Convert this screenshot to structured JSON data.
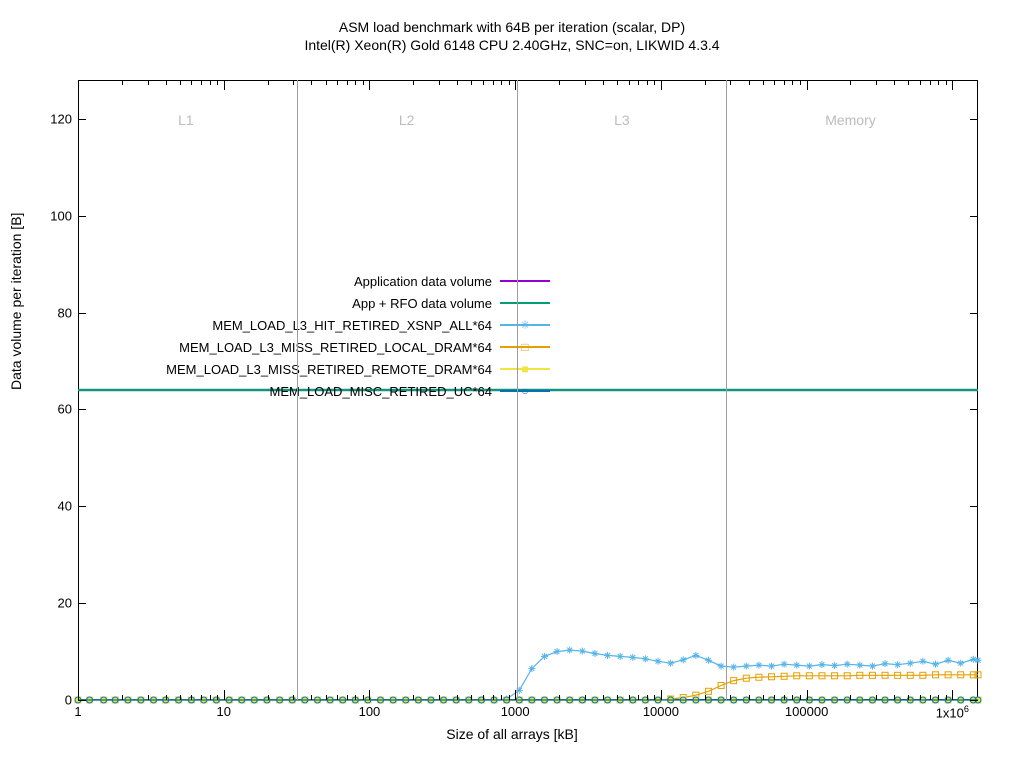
{
  "title": {
    "line1": "ASM load benchmark with 64B per iteration (scalar, DP)",
    "line2": "Intel(R) Xeon(R) Gold 6148 CPU 2.40GHz, SNC=on, LIKWID 4.3.4"
  },
  "axes": {
    "xlabel": "Size of all arrays [kB]",
    "ylabel": "Data volume per iteration [B]",
    "y_ticks": [
      0,
      20,
      40,
      60,
      80,
      100,
      120
    ],
    "x_ticks_log": [
      1,
      10,
      100,
      1000,
      10000,
      100000,
      1000000
    ],
    "x_tick_labels": [
      "1",
      "10",
      "100",
      "1000",
      "10000",
      "100000",
      "1x10⁶"
    ],
    "xlim": [
      1,
      1500000
    ],
    "ylim": [
      0,
      128
    ]
  },
  "regions": {
    "labels": [
      "L1",
      "L2",
      "L3",
      "Memory"
    ],
    "boundaries_kB": [
      32,
      1024,
      28160
    ],
    "label_x_kB": [
      5.5,
      180,
      5400,
      200000
    ]
  },
  "legend": {
    "items": [
      {
        "label": "Application data volume",
        "color": "#9400d3",
        "marker": ""
      },
      {
        "label": "App + RFO data volume",
        "color": "#009e73",
        "marker": ""
      },
      {
        "label": "MEM_LOAD_L3_HIT_RETIRED_XSNP_ALL*64",
        "color": "#56b4e9",
        "marker": "✳"
      },
      {
        "label": "MEM_LOAD_L3_MISS_RETIRED_LOCAL_DRAM*64",
        "color": "#e69f00",
        "marker": "□"
      },
      {
        "label": "MEM_LOAD_L3_MISS_RETIRED_REMOTE_DRAM*64",
        "color": "#f0e442",
        "marker": "■"
      },
      {
        "label": "MEM_LOAD_MISC_RETIRED_UC*64",
        "color": "#0072b2",
        "marker": "○"
      }
    ]
  },
  "chart_data": {
    "type": "line",
    "x_scale": "log",
    "xlabel": "Size of all arrays [kB]",
    "ylabel": "Data volume per iteration [B]",
    "xlim": [
      1,
      1500000
    ],
    "ylim": [
      0,
      128
    ],
    "x": [
      1,
      1.2,
      1.5,
      1.8,
      2.2,
      2.7,
      3.3,
      4,
      4.9,
      6,
      7.3,
      8.9,
      10.9,
      13.3,
      16.2,
      19.8,
      24.2,
      29.5,
      36,
      44,
      53.7,
      65.5,
      80,
      97.6,
      119.1,
      145.4,
      177.5,
      216.6,
      264.4,
      322.7,
      393.9,
      480.7,
      586.7,
      716,
      874,
      1067,
      1302,
      1589,
      1939,
      2367,
      2889,
      3527,
      4305,
      5255,
      6414,
      7829,
      9555,
      11663,
      14234,
      17373,
      21204,
      25879,
      31585,
      38550,
      47051,
      57429,
      70095,
      85557,
      104421,
      127466,
      155577,
      189888,
      231780,
      282896,
      345284,
      421427,
      514344,
      627769,
      766225,
      935213,
      1141471,
      1393204,
      1500000
    ],
    "series": [
      {
        "name": "Application data volume",
        "color": "#9400d3",
        "constant": 64
      },
      {
        "name": "App + RFO data volume",
        "color": "#009e73",
        "constant": 64
      },
      {
        "name": "MEM_LOAD_L3_HIT_RETIRED_XSNP_ALL*64",
        "color": "#56b4e9",
        "marker": "star",
        "values": [
          0,
          0,
          0,
          0,
          0,
          0,
          0,
          0,
          0,
          0,
          0,
          0,
          0,
          0,
          0,
          0,
          0,
          0,
          0,
          0,
          0,
          0,
          0,
          0,
          0,
          0,
          0,
          0,
          0,
          0,
          0,
          0,
          0,
          0,
          0.2,
          2.0,
          6.5,
          9.0,
          10.0,
          10.3,
          10.1,
          9.6,
          9.2,
          9.0,
          8.8,
          8.5,
          8.0,
          7.6,
          8.3,
          9.2,
          8.2,
          7.0,
          6.8,
          7.0,
          7.2,
          7.0,
          7.4,
          7.2,
          7.0,
          7.3,
          7.1,
          7.4,
          7.2,
          7.0,
          7.5,
          7.3,
          7.6,
          8.0,
          7.4,
          8.2,
          7.6,
          8.4,
          8.2
        ]
      },
      {
        "name": "MEM_LOAD_L3_MISS_RETIRED_LOCAL_DRAM*64",
        "color": "#e69f00",
        "marker": "square-open",
        "values": [
          0,
          0,
          0,
          0,
          0,
          0,
          0,
          0,
          0,
          0,
          0,
          0,
          0,
          0,
          0,
          0,
          0,
          0,
          0,
          0,
          0,
          0,
          0,
          0,
          0,
          0,
          0,
          0,
          0,
          0,
          0,
          0,
          0,
          0,
          0,
          0,
          0,
          0,
          0,
          0,
          0,
          0,
          0,
          0,
          0,
          0,
          0,
          0.2,
          0.5,
          1.0,
          1.8,
          3.0,
          4.0,
          4.5,
          4.7,
          4.8,
          4.9,
          5.0,
          5.0,
          5.0,
          5.0,
          5.0,
          5.1,
          5.1,
          5.1,
          5.1,
          5.1,
          5.1,
          5.2,
          5.2,
          5.2,
          5.2,
          5.2
        ]
      },
      {
        "name": "MEM_LOAD_L3_MISS_RETIRED_REMOTE_DRAM*64",
        "color": "#f0e442",
        "marker": "square",
        "values": [
          0,
          0,
          0,
          0,
          0,
          0,
          0,
          0,
          0,
          0,
          0,
          0,
          0,
          0,
          0,
          0,
          0,
          0,
          0,
          0,
          0,
          0,
          0,
          0,
          0,
          0,
          0,
          0,
          0,
          0,
          0,
          0,
          0,
          0,
          0,
          0,
          0,
          0,
          0,
          0,
          0,
          0,
          0,
          0,
          0,
          0,
          0,
          0,
          0,
          0,
          0,
          0,
          0,
          0,
          0,
          0,
          0,
          0,
          0,
          0,
          0,
          0,
          0,
          0,
          0,
          0,
          0,
          0,
          0,
          0,
          0,
          0,
          0
        ]
      },
      {
        "name": "MEM_LOAD_MISC_RETIRED_UC*64",
        "color": "#0072b2",
        "marker": "circle-open",
        "values": [
          0,
          0,
          0,
          0,
          0,
          0,
          0,
          0,
          0,
          0,
          0,
          0,
          0,
          0,
          0,
          0,
          0,
          0,
          0,
          0,
          0,
          0,
          0,
          0,
          0,
          0,
          0,
          0,
          0,
          0,
          0,
          0,
          0,
          0,
          0,
          0,
          0,
          0,
          0,
          0,
          0,
          0,
          0,
          0,
          0,
          0,
          0,
          0,
          0,
          0,
          0,
          0,
          0,
          0,
          0,
          0,
          0,
          0,
          0,
          0,
          0,
          0,
          0,
          0,
          0,
          0,
          0,
          0,
          0,
          0,
          0,
          0,
          0
        ]
      }
    ],
    "regions": {
      "L1_end_kB": 32,
      "L2_end_kB": 1024,
      "L3_end_kB": 28160
    }
  }
}
